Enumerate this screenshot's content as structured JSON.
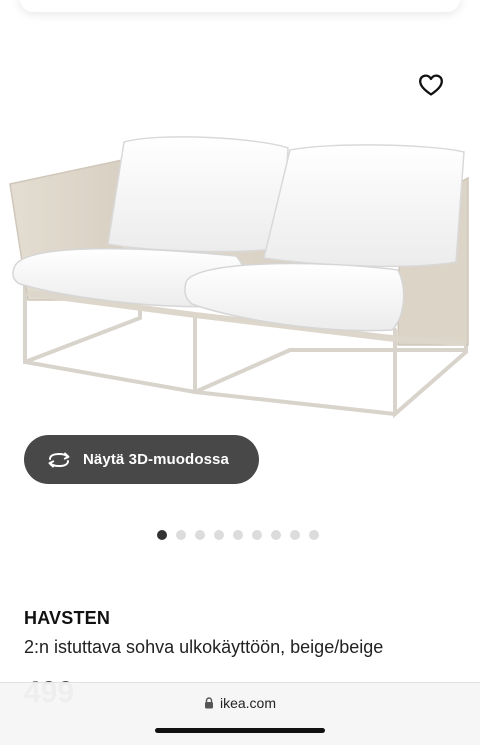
{
  "product": {
    "name": "HAVSTEN",
    "description": "2:n istuttava sohva ulkokäyttöön, beige/beige",
    "price_partial": "499"
  },
  "gallery": {
    "view_3d_label": "Näytä 3D-muodossa",
    "total_images": 9,
    "active_index": 0
  },
  "browser": {
    "url": "ikea.com"
  },
  "icons": {
    "favorite": "heart-outline-icon",
    "view3d": "rotate-3d-icon",
    "lock": "lock-icon"
  },
  "colors": {
    "button_bg": "#484848",
    "dot_active": "#333333",
    "dot_inactive": "#dcdcdc"
  }
}
